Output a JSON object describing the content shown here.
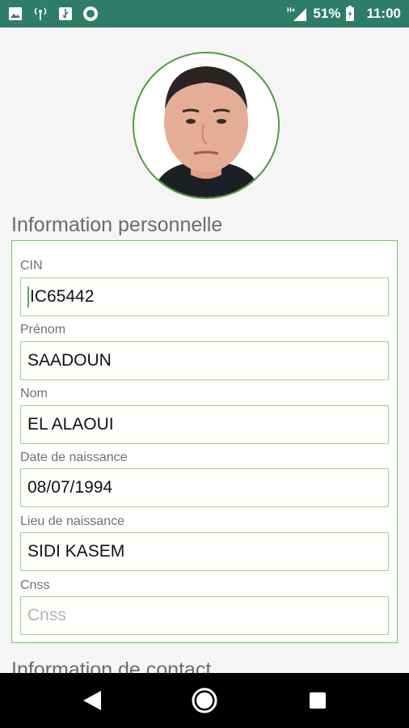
{
  "status_bar": {
    "network": "H+",
    "battery_percent": "51%",
    "time": "11:00",
    "icons": [
      "image-icon",
      "broadcast-icon",
      "usb-icon",
      "record-icon",
      "signal-icon",
      "battery-icon"
    ],
    "background_color": "#2e7d67"
  },
  "profile": {
    "avatar_icon": "profile-photo"
  },
  "sections": {
    "personal_title": "Information personnelle",
    "contact_title": "Information de contact"
  },
  "fields": [
    {
      "label": "CIN",
      "value": "IC65442",
      "placeholder": ""
    },
    {
      "label": "Prénom",
      "value": "SAADOUN",
      "placeholder": ""
    },
    {
      "label": "Nom",
      "value": "EL ALAOUI",
      "placeholder": ""
    },
    {
      "label": "Date de naissance",
      "value": "08/07/1994",
      "placeholder": ""
    },
    {
      "label": "Lieu de naissance",
      "value": "SIDI KASEM",
      "placeholder": ""
    },
    {
      "label": "Cnss",
      "value": "",
      "placeholder": "Cnss"
    }
  ],
  "colors": {
    "accent_green": "#4caf50",
    "border_green": "#7cc06a"
  },
  "nav": {
    "icons": [
      "back-icon",
      "home-icon",
      "recent-apps-icon"
    ]
  }
}
